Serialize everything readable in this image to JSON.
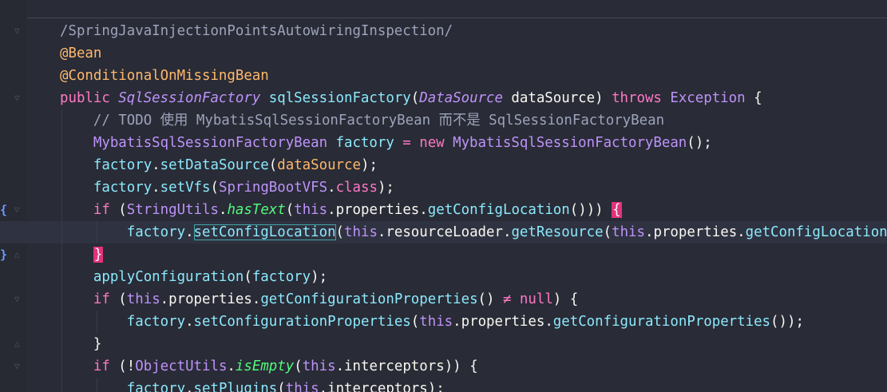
{
  "editor": {
    "lines": [
      {
        "fold": "▽",
        "tokens": [
          [
            "c-comment",
            "/SpringJavaInjectionPointsAutowiringInspection/"
          ]
        ]
      },
      {
        "fold": "",
        "tokens": [
          [
            "c-anno",
            "@Bean"
          ]
        ]
      },
      {
        "fold": "",
        "tokens": [
          [
            "c-anno",
            "@ConditionalOnMissingBean"
          ]
        ]
      },
      {
        "fold": "▽",
        "tokens": [
          [
            "c-kw",
            "public "
          ],
          [
            "c-type",
            "SqlSessionFactory "
          ],
          [
            "c-meth",
            "sqlSessionFactory"
          ],
          [
            "c-plain",
            "("
          ],
          [
            "c-type",
            "DataSource "
          ],
          [
            "c-plain",
            "dataSource) "
          ],
          [
            "c-kw",
            "throws "
          ],
          [
            "c-cls",
            "Exception "
          ],
          [
            "c-plain",
            "{"
          ]
        ]
      },
      {
        "fold": "",
        "tokens": [
          [
            "c-comment",
            "    // TODO 使用 MybatisSqlSessionFactoryBean 而不是 SqlSessionFactoryBean"
          ]
        ]
      },
      {
        "fold": "",
        "tokens": [
          [
            "c-cls",
            "    MybatisSqlSessionFactoryBean "
          ],
          [
            "c-var",
            "factory "
          ],
          [
            "c-kw",
            "= new "
          ],
          [
            "c-cls",
            "MybatisSqlSessionFactoryBean"
          ],
          [
            "c-plain",
            "();"
          ]
        ]
      },
      {
        "fold": "",
        "tokens": [
          [
            "c-var",
            "    factory"
          ],
          [
            "c-plain",
            "."
          ],
          [
            "c-meth",
            "setDataSource"
          ],
          [
            "c-plain",
            "("
          ],
          [
            "c-param",
            "dataSource"
          ],
          [
            "c-plain",
            ");"
          ]
        ]
      },
      {
        "fold": "",
        "tokens": [
          [
            "c-var",
            "    factory"
          ],
          [
            "c-plain",
            "."
          ],
          [
            "c-meth",
            "setVfs"
          ],
          [
            "c-plain",
            "("
          ],
          [
            "c-cls",
            "SpringBootVFS"
          ],
          [
            "c-plain",
            "."
          ],
          [
            "c-kw",
            "class"
          ],
          [
            "c-plain",
            ");"
          ]
        ]
      },
      {
        "fold": "▽",
        "tokens": [
          [
            "c-kw",
            "    if "
          ],
          [
            "c-plain",
            "("
          ],
          [
            "c-cls",
            "StringUtils"
          ],
          [
            "c-plain",
            "."
          ],
          [
            "c-meth-i",
            "hasText"
          ],
          [
            "c-plain",
            "("
          ],
          [
            "c-this",
            "this"
          ],
          [
            "c-plain",
            ".properties."
          ],
          [
            "c-meth",
            "getConfigLocation"
          ],
          [
            "c-plain",
            "())) "
          ],
          [
            "brace-hl",
            "{"
          ]
        ]
      },
      {
        "fold": "",
        "tokens": [
          [
            "c-var",
            "        factory"
          ],
          [
            "c-plain",
            "."
          ],
          [
            "c-meth word-hl",
            "setConfigLocation"
          ],
          [
            "c-plain",
            "("
          ],
          [
            "c-this",
            "this"
          ],
          [
            "c-plain",
            ".resourceLoader."
          ],
          [
            "c-meth",
            "getResource"
          ],
          [
            "c-plain",
            "("
          ],
          [
            "c-this",
            "this"
          ],
          [
            "c-plain",
            ".properties."
          ],
          [
            "c-meth",
            "getConfigLocation"
          ],
          [
            "c-plain",
            "()));"
          ]
        ]
      },
      {
        "fold": "△",
        "tokens": [
          [
            "c-plain",
            "    "
          ],
          [
            "brace-hl",
            "}"
          ]
        ]
      },
      {
        "fold": "",
        "tokens": [
          [
            "c-meth",
            "    applyConfiguration"
          ],
          [
            "c-plain",
            "("
          ],
          [
            "c-var",
            "factory"
          ],
          [
            "c-plain",
            ");"
          ]
        ]
      },
      {
        "fold": "▽",
        "tokens": [
          [
            "c-kw",
            "    if "
          ],
          [
            "c-plain",
            "("
          ],
          [
            "c-this",
            "this"
          ],
          [
            "c-plain",
            ".properties."
          ],
          [
            "c-meth",
            "getConfigurationProperties"
          ],
          [
            "c-plain",
            "() "
          ],
          [
            "c-kw",
            "≠ null"
          ],
          [
            "c-plain",
            ") {"
          ]
        ]
      },
      {
        "fold": "",
        "tokens": [
          [
            "c-var",
            "        factory"
          ],
          [
            "c-plain",
            "."
          ],
          [
            "c-meth",
            "setConfigurationProperties"
          ],
          [
            "c-plain",
            "("
          ],
          [
            "c-this",
            "this"
          ],
          [
            "c-plain",
            ".properties."
          ],
          [
            "c-meth",
            "getConfigurationProperties"
          ],
          [
            "c-plain",
            "());"
          ]
        ]
      },
      {
        "fold": "△",
        "tokens": [
          [
            "c-plain",
            "    }"
          ]
        ]
      },
      {
        "fold": "▽",
        "tokens": [
          [
            "c-kw",
            "    if "
          ],
          [
            "c-plain",
            "(!"
          ],
          [
            "c-cls",
            "ObjectUtils"
          ],
          [
            "c-plain",
            "."
          ],
          [
            "c-meth-i",
            "isEmpty"
          ],
          [
            "c-plain",
            "("
          ],
          [
            "c-this",
            "this"
          ],
          [
            "c-plain",
            ".interceptors)) {"
          ]
        ]
      },
      {
        "fold": "",
        "tokens": [
          [
            "c-var",
            "        factory"
          ],
          [
            "c-plain",
            "."
          ],
          [
            "c-meth",
            "setPlugins"
          ],
          [
            "c-plain",
            "("
          ],
          [
            "c-this",
            "this"
          ],
          [
            "c-plain",
            ".interceptors);"
          ]
        ]
      }
    ]
  },
  "colors": {
    "background": "#292b36",
    "brace_highlight": "#e3317d",
    "word_highlight_border": "#3fa7a7"
  }
}
